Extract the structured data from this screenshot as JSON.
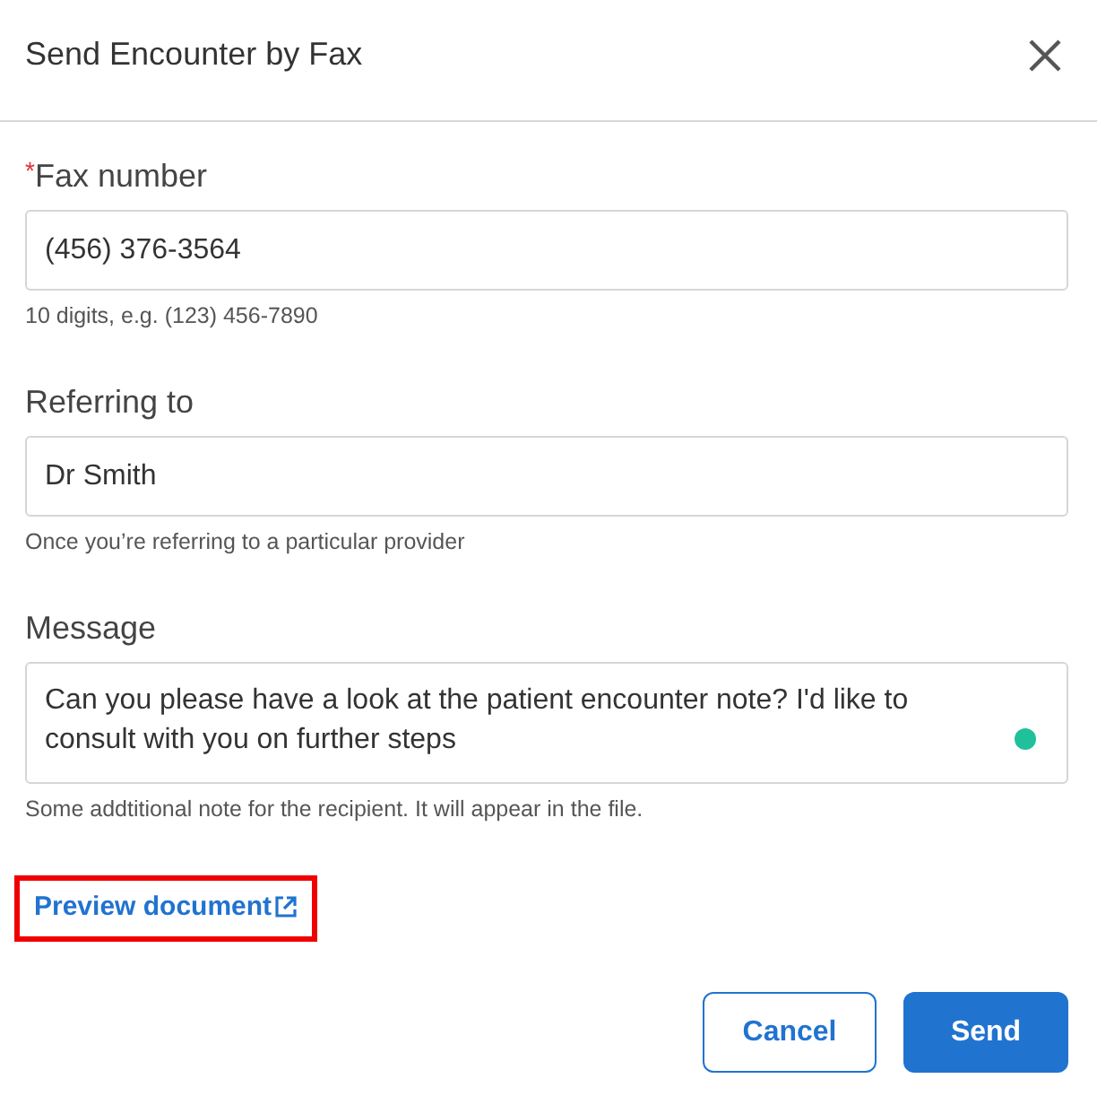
{
  "dialog": {
    "title": "Send Encounter by Fax"
  },
  "fields": [
    {
      "kind": "input",
      "label": "Fax number",
      "required_mark": "*",
      "value": "(456) 376-3564",
      "hint": "10 digits, e.g. (123) 456-7890"
    },
    {
      "kind": "input",
      "label": "Referring to",
      "value": "Dr Smith",
      "hint": "Once you’re referring to a particular provider"
    },
    {
      "kind": "textarea",
      "label": "Message",
      "value": "Can you please have a look at the patient encounter note? I'd like to consult with you on further steps",
      "hint": "Some addtitional note for the recipient. It will appear in the file."
    }
  ],
  "preview_link": {
    "label": "Preview document",
    "highlighted": true
  },
  "buttons": [
    {
      "label": "Cancel",
      "kind": "secondary"
    },
    {
      "label": "Send",
      "kind": "primary"
    }
  ]
}
